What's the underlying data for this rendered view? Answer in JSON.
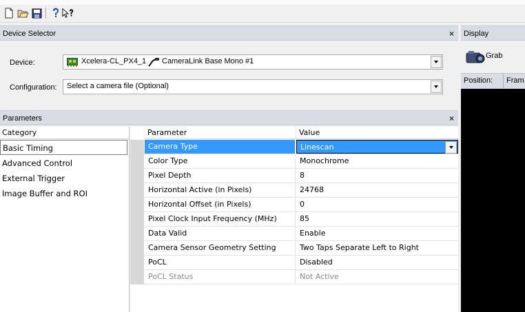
{
  "toolbar": {
    "icons": [
      "new-document-icon",
      "open-folder-icon",
      "save-disk-icon",
      "help-icon",
      "context-help-icon"
    ]
  },
  "device_selector": {
    "title": "Device Selector",
    "close": "×",
    "device_label": "Device:",
    "device_value": "Xcelera-CL_PX4_1",
    "device_subvalue": "CameraLink Base Mono #1",
    "configuration_label": "Configuration:",
    "configuration_value": "Select a camera file (Optional)"
  },
  "display": {
    "title": "Display",
    "grab_label": "Grab",
    "position_label": "Position:",
    "frame_label": "Fram"
  },
  "parameters": {
    "title": "Parameters",
    "close": "×",
    "category_header": "Category",
    "categories": [
      "Basic Timing",
      "Advanced Control",
      "External Trigger",
      "Image Buffer and ROI"
    ],
    "selected_category": "Basic Timing",
    "columns": {
      "parameter": "Parameter",
      "value": "Value"
    },
    "rows": [
      {
        "parameter": "Camera Type",
        "value": "Linescan"
      },
      {
        "parameter": "Color Type",
        "value": "Monochrome"
      },
      {
        "parameter": "Pixel Depth",
        "value": "8"
      },
      {
        "parameter": "Horizontal Active (in Pixels)",
        "value": "24768"
      },
      {
        "parameter": "Horizontal Offset (in Pixels)",
        "value": "0"
      },
      {
        "parameter": "Pixel Clock Input Frequency (MHz)",
        "value": "85"
      },
      {
        "parameter": "Data Valid",
        "value": "Enable"
      },
      {
        "parameter": "Camera Sensor Geometry Setting",
        "value": "Two Taps Separate Left to Right"
      },
      {
        "parameter": "PoCL",
        "value": "Disabled"
      },
      {
        "parameter": "PoCL Status",
        "value": "Not Active"
      }
    ]
  },
  "colors": {
    "selection": "#3399ff",
    "panel_header": "#d9dde3",
    "display_background": "#000000"
  }
}
